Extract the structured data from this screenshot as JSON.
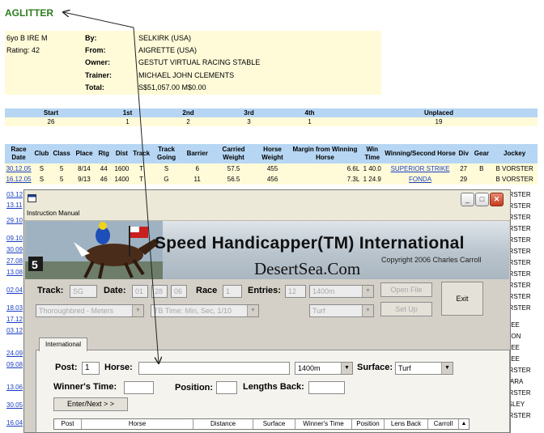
{
  "horse": {
    "name": "AGLITTER",
    "description": "6yo B IRE M",
    "rating": "Rating: 42"
  },
  "breeding": [
    {
      "label": "By:",
      "value": "SELKIRK (USA)"
    },
    {
      "label": "From:",
      "value": "AIGRETTE (USA)"
    },
    {
      "label": "Owner:",
      "value": "GESTUT VIRTUAL RACING STABLE"
    },
    {
      "label": "Trainer:",
      "value": "MICHAEL JOHN CLEMENTS"
    },
    {
      "label": "Total:",
      "value": "S$51,057.00 M$0.00"
    }
  ],
  "stats": {
    "headers": [
      "Start",
      "1st",
      "2nd",
      "3rd",
      "4th",
      "Unplaced"
    ],
    "values": [
      "26",
      "1",
      "2",
      "3",
      "1",
      "19"
    ]
  },
  "race_table": {
    "headers": [
      "Race Date",
      "Club",
      "Class",
      "Place",
      "Rtg",
      "Dist",
      "Track",
      "Track Going",
      "Barrier",
      "Carried Weight",
      "Horse Weight",
      "Margin from Winning Horse",
      "Win Time",
      "Winning/Second Horse",
      "Div",
      "Gear",
      "Jockey"
    ],
    "rows": [
      [
        "30.12.05",
        "S",
        "5",
        "8/14",
        "44",
        "1600",
        "T",
        "S",
        "6",
        "57.5",
        "455",
        "6.6L",
        "1 40.0",
        "SUPERIOR STRIKE",
        "27",
        "B",
        "B VORSTER"
      ],
      [
        "16.12.05",
        "S",
        "5",
        "9/13",
        "46",
        "1400",
        "T",
        "G",
        "11",
        "56.5",
        "456",
        "7.3L",
        "1 24.9",
        "FONDA",
        "29",
        "",
        "B VORSTER"
      ]
    ],
    "more_dates": [
      "03.12",
      "13.11",
      "29.10",
      "09.10",
      "30.09",
      "27.08",
      "13.08",
      "02.04",
      "18.03",
      "17.12",
      "03.12",
      "24.09",
      "09.08",
      "13.06",
      "30.05",
      "16.04"
    ],
    "more_jockeys": [
      "VORSTER",
      "VORSTER",
      "VORSTER",
      "VORSTER",
      "VORSTER",
      "VORSTER",
      "VORSTER",
      "VORSTER",
      "VORSTER",
      "VORSTER",
      "VORSTER",
      "AIMEE",
      "ATTON",
      "AIMEE",
      "AIMEE",
      "VORSTER",
      "K SARA",
      "VORSTER",
      "EASLEY",
      "VORSTER"
    ]
  },
  "app": {
    "menu": "Instruction Manual",
    "banner": {
      "title": "Speed Handicapper(TM) International",
      "copyright": "Copyright 2006 Charles Carroll",
      "site": "DesertSea.Com"
    },
    "row1": {
      "track_label": "Track:",
      "track_value": "SG",
      "date_label": "Date:",
      "day": "01",
      "month": "28",
      "year": "06",
      "race_label": "Race",
      "race_value": "1",
      "entries_label": "Entries:",
      "entries_value": "12",
      "distance": "1400m",
      "open_file": "Open File",
      "exit": "Exit"
    },
    "row2": {
      "breed_units": "Thoroughbred - Meters",
      "time_format": "TB Time: Min, Sec, 1/10",
      "surface": "Turf",
      "set_up": "Set Up"
    },
    "tab": "International",
    "entry": {
      "post_label": "Post:",
      "post_value": "1",
      "horse_label": "Horse:",
      "horse_value": "",
      "distance": "1400m",
      "surface_label": "Surface:",
      "surface_value": "Turf",
      "winners_time_label": "Winner's Time:",
      "position_label": "Position:",
      "lengths_back_label": "Lengths Back:",
      "enter_next": "Enter/Next > >"
    },
    "grid_headers": [
      "Post",
      "Horse",
      "Distance",
      "Surface",
      "Winner's Time",
      "Position",
      "Lens Back",
      "Carroll"
    ]
  },
  "colors": {
    "header_blue": "#b6d6f3",
    "row_cream": "#fffbd9",
    "title_green": "#2e7d1f",
    "link_blue": "#1a3fc4"
  }
}
